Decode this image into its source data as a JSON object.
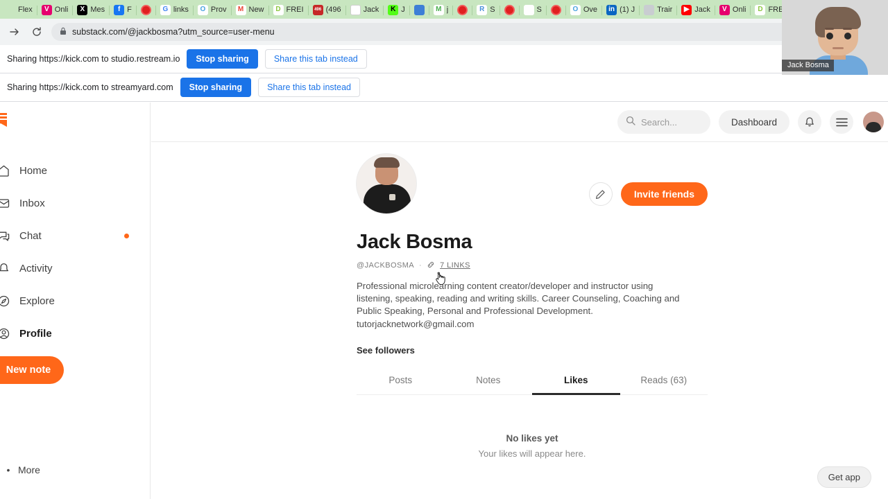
{
  "browser": {
    "url": "substack.com/@jackbosma?utm_source=user-menu",
    "lock_icon": "lock-icon",
    "forward_icon": "forward-arrow-icon",
    "reload_icon": "reload-icon",
    "newtab_label": "+",
    "close_label": "×",
    "tabs": [
      {
        "label": "Flex",
        "favicon": "flex-icon",
        "color": "#1f7a4d",
        "glyph": "",
        "active": false
      },
      {
        "label": "Onli",
        "favicon": "vimeo-icon",
        "color": "#e6006e",
        "glyph": "V",
        "active": false
      },
      {
        "label": "Mes",
        "favicon": "x-twitter-icon",
        "color": "#000000",
        "glyph": "X",
        "active": false
      },
      {
        "label": "F",
        "favicon": "facebook-icon",
        "color": "#1877f2",
        "glyph": "f",
        "active": false
      },
      {
        "label": "",
        "favicon": "record-dot-icon",
        "color": "#e02020",
        "glyph": "",
        "active": false
      },
      {
        "label": "links",
        "favicon": "google-icon",
        "color": "#ffffff",
        "glyph": "G",
        "active": false
      },
      {
        "label": "Prov",
        "favicon": "circle-o-icon",
        "color": "#ffffff",
        "glyph": "O",
        "active": false
      },
      {
        "label": "New",
        "favicon": "gmail-icon",
        "color": "#ffffff",
        "glyph": "M",
        "active": false
      },
      {
        "label": "FREI",
        "favicon": "play-circle-icon",
        "color": "#ffffff",
        "glyph": "D",
        "active": false
      },
      {
        "label": "(496",
        "favicon": "redbadge-icon",
        "color": "#c62828",
        "glyph": "496",
        "active": false
      },
      {
        "label": "Jack",
        "favicon": "blank-page-icon",
        "color": "#ffffff",
        "glyph": "",
        "active": false
      },
      {
        "label": "J",
        "favicon": "kick-icon",
        "color": "#53fc18",
        "glyph": "K",
        "active": false
      },
      {
        "label": "",
        "favicon": "blue-square-icon",
        "color": "#3d7fd6",
        "glyph": "",
        "active": false
      },
      {
        "label": "j",
        "favicon": "m-letter-icon",
        "color": "#ffffff",
        "glyph": "M",
        "active": false
      },
      {
        "label": "",
        "favicon": "record-dot-icon",
        "color": "#e02020",
        "glyph": "",
        "active": false
      },
      {
        "label": "S",
        "favicon": "reddit-icon",
        "color": "#ffffff",
        "glyph": "R",
        "active": false
      },
      {
        "label": "",
        "favicon": "record-dot-icon",
        "color": "#e02020",
        "glyph": "",
        "active": false
      },
      {
        "label": "S",
        "favicon": "parrot-icon",
        "color": "#ffffff",
        "glyph": "",
        "active": false
      },
      {
        "label": "",
        "favicon": "record-dot-icon",
        "color": "#e02020",
        "glyph": "",
        "active": false
      },
      {
        "label": "Ove",
        "favicon": "circle-o-icon",
        "color": "#ffffff",
        "glyph": "O",
        "active": false
      },
      {
        "label": "(1) J",
        "favicon": "linkedin-icon",
        "color": "#0a66c2",
        "glyph": "in",
        "active": false
      },
      {
        "label": "Trair",
        "favicon": "gray-disc-icon",
        "color": "#c9cdd1",
        "glyph": "",
        "active": false
      },
      {
        "label": "Jack",
        "favicon": "youtube-icon",
        "color": "#ff0000",
        "glyph": "▶",
        "active": false
      },
      {
        "label": "Onli",
        "favicon": "vimeo-icon",
        "color": "#e6006e",
        "glyph": "V",
        "active": false
      },
      {
        "label": "FREI",
        "favicon": "play-circle-icon",
        "color": "#ffffff",
        "glyph": "D",
        "active": false
      },
      {
        "label": "",
        "favicon": "substack-icon",
        "color": "#ff6719",
        "glyph": "",
        "active": true
      }
    ]
  },
  "share_bars": [
    {
      "text": "Sharing https://kick.com to studio.restream.io",
      "stop_label": "Stop sharing",
      "share_label": "Share this tab instead"
    },
    {
      "text": "Sharing https://kick.com to streamyard.com",
      "stop_label": "Stop sharing",
      "share_label": "Share this tab instead"
    }
  ],
  "sidebar": {
    "logo_icon": "substack-logo-icon",
    "items": [
      {
        "label": "Home",
        "icon": "home-icon",
        "badge": false
      },
      {
        "label": "Inbox",
        "icon": "inbox-icon",
        "badge": false
      },
      {
        "label": "Chat",
        "icon": "chat-icon",
        "badge": true
      },
      {
        "label": "Activity",
        "icon": "activity-bell-icon",
        "badge": false
      },
      {
        "label": "Explore",
        "icon": "compass-icon",
        "badge": false
      },
      {
        "label": "Profile",
        "icon": "profile-icon",
        "badge": false
      }
    ],
    "new_note_label": "New note",
    "more_label": "More"
  },
  "topbar": {
    "search_placeholder": "Search...",
    "search_icon": "search-icon",
    "dashboard_label": "Dashboard",
    "bell_icon": "bell-icon",
    "menu_icon": "hamburger-menu-icon",
    "avatar": "user-avatar"
  },
  "profile": {
    "avatar": "profile-photo",
    "edit_icon": "pencil-edit-icon",
    "invite_label": "Invite friends",
    "name": "Jack Bosma",
    "handle": "@JACKBOSMA",
    "separator": "·",
    "link_icon": "link-chain-icon",
    "links_label": "7 LINKS",
    "bio": "Professional microlearning content creator/developer and instructor using listening, speaking, reading and writing skills. Career Counseling, Coaching and Public Speaking, Personal and Professional Development. tutorjacknetwork@gmail.com",
    "see_followers_label": "See followers",
    "tabs": [
      {
        "label": "Posts",
        "selected": false
      },
      {
        "label": "Notes",
        "selected": false
      },
      {
        "label": "Likes",
        "selected": true
      },
      {
        "label": "Reads (63)",
        "selected": false
      }
    ],
    "empty_title": "No likes yet",
    "empty_subtitle": "Your likes will appear here."
  },
  "footer": {
    "get_app_label": "Get app"
  },
  "webcam": {
    "name_label": "Jack Bosma"
  },
  "colors": {
    "substack_orange": "#ff6719",
    "chrome_blue": "#1a73e8",
    "tabstrip_green": "#c8e6c0"
  }
}
